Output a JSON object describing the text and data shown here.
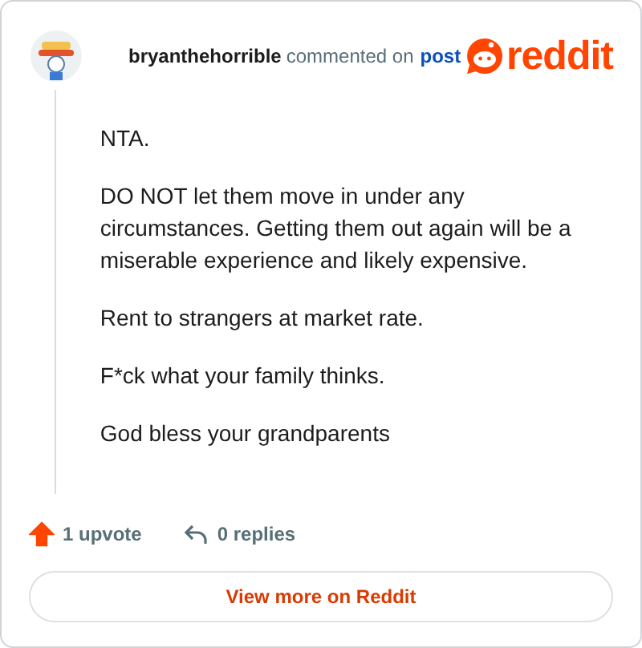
{
  "header": {
    "username": "bryanthehorrible",
    "action": "commented on",
    "link": "post",
    "brand": "reddit"
  },
  "body": [
    "NTA.",
    "DO NOT let them move in under any circumstances. Getting them out again will be a miserable experience and likely expensive.",
    "Rent to strangers at market rate.",
    "F*ck what your family thinks.",
    "God bless your grandparents"
  ],
  "footer": {
    "upvotes": "1 upvote",
    "upvoted": true,
    "replies": "0 replies"
  },
  "button": "View more on Reddit"
}
